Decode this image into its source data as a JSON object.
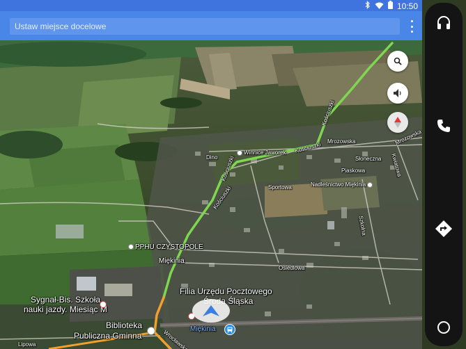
{
  "status": {
    "time": "10:50"
  },
  "search": {
    "placeholder": "Ustaw miejsce docelowe"
  },
  "labels": {
    "winnice": "Winnice Jaworek",
    "kosciuszki_top": "Kościuszki",
    "kosciuszki_mid": "Kościuszki",
    "kosciuszki_left": "Kościuszki",
    "kosciuszki_low": "Kościuszki",
    "mrozowska": "Mrozowska",
    "mrozowska_right": "Mrozowska",
    "sloneczna": "Słoneczna",
    "piaskowa": "Piaskowa",
    "kwiatowa": "Kwiatowa",
    "dino": "Dino",
    "sportowa": "Sportowa",
    "nadlesnictwo": "Nadleśnictwo Miękinia",
    "szkolna": "Szkolna",
    "pphu": "PPHU CZYSTOPOLE",
    "miekinia_top": "Miękinia",
    "osiedlowa": "Osiedlowa",
    "filia1": "Filia Urzędu Pocztowego",
    "filia2": "Środa Śląska",
    "sygnal1": "Sygnał-Bis. Szkoła",
    "sygnal2": "nauki jazdy. Miesiąc M",
    "biblioteka1": "Biblioteka",
    "biblioteka2": "Publiczna Gminna",
    "miekinia_station": "Miękinia",
    "lipowa": "Lipowa",
    "wroclawska": "Wrocławska"
  },
  "colors": {
    "status_bar": "#3f74df",
    "app_bar": "#4a86e8",
    "route_green": "#7fd650",
    "route_orange": "#f2a02c",
    "rail_bg": "#141414"
  },
  "icons": {
    "status": [
      "bluetooth-icon",
      "wifi-icon",
      "battery-icon"
    ],
    "map_buttons": [
      "search-icon",
      "volume-icon",
      "compass-icon"
    ],
    "rail": [
      "headset-icon",
      "phone-icon",
      "navigation-icon",
      "home-circle-icon"
    ]
  }
}
